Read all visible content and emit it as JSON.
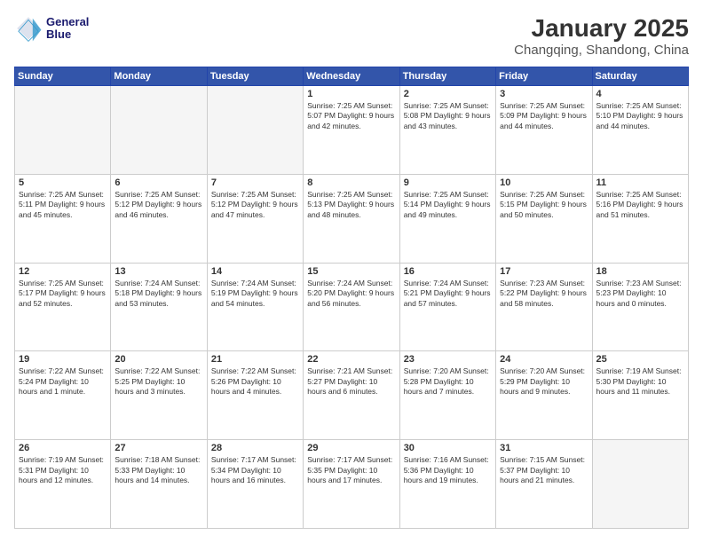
{
  "header": {
    "logo_line1": "General",
    "logo_line2": "Blue",
    "month_title": "January 2025",
    "location": "Changqing, Shandong, China"
  },
  "days_of_week": [
    "Sunday",
    "Monday",
    "Tuesday",
    "Wednesday",
    "Thursday",
    "Friday",
    "Saturday"
  ],
  "weeks": [
    [
      {
        "day": "",
        "text": ""
      },
      {
        "day": "",
        "text": ""
      },
      {
        "day": "",
        "text": ""
      },
      {
        "day": "1",
        "text": "Sunrise: 7:25 AM\nSunset: 5:07 PM\nDaylight: 9 hours\nand 42 minutes."
      },
      {
        "day": "2",
        "text": "Sunrise: 7:25 AM\nSunset: 5:08 PM\nDaylight: 9 hours\nand 43 minutes."
      },
      {
        "day": "3",
        "text": "Sunrise: 7:25 AM\nSunset: 5:09 PM\nDaylight: 9 hours\nand 44 minutes."
      },
      {
        "day": "4",
        "text": "Sunrise: 7:25 AM\nSunset: 5:10 PM\nDaylight: 9 hours\nand 44 minutes."
      }
    ],
    [
      {
        "day": "5",
        "text": "Sunrise: 7:25 AM\nSunset: 5:11 PM\nDaylight: 9 hours\nand 45 minutes."
      },
      {
        "day": "6",
        "text": "Sunrise: 7:25 AM\nSunset: 5:12 PM\nDaylight: 9 hours\nand 46 minutes."
      },
      {
        "day": "7",
        "text": "Sunrise: 7:25 AM\nSunset: 5:12 PM\nDaylight: 9 hours\nand 47 minutes."
      },
      {
        "day": "8",
        "text": "Sunrise: 7:25 AM\nSunset: 5:13 PM\nDaylight: 9 hours\nand 48 minutes."
      },
      {
        "day": "9",
        "text": "Sunrise: 7:25 AM\nSunset: 5:14 PM\nDaylight: 9 hours\nand 49 minutes."
      },
      {
        "day": "10",
        "text": "Sunrise: 7:25 AM\nSunset: 5:15 PM\nDaylight: 9 hours\nand 50 minutes."
      },
      {
        "day": "11",
        "text": "Sunrise: 7:25 AM\nSunset: 5:16 PM\nDaylight: 9 hours\nand 51 minutes."
      }
    ],
    [
      {
        "day": "12",
        "text": "Sunrise: 7:25 AM\nSunset: 5:17 PM\nDaylight: 9 hours\nand 52 minutes."
      },
      {
        "day": "13",
        "text": "Sunrise: 7:24 AM\nSunset: 5:18 PM\nDaylight: 9 hours\nand 53 minutes."
      },
      {
        "day": "14",
        "text": "Sunrise: 7:24 AM\nSunset: 5:19 PM\nDaylight: 9 hours\nand 54 minutes."
      },
      {
        "day": "15",
        "text": "Sunrise: 7:24 AM\nSunset: 5:20 PM\nDaylight: 9 hours\nand 56 minutes."
      },
      {
        "day": "16",
        "text": "Sunrise: 7:24 AM\nSunset: 5:21 PM\nDaylight: 9 hours\nand 57 minutes."
      },
      {
        "day": "17",
        "text": "Sunrise: 7:23 AM\nSunset: 5:22 PM\nDaylight: 9 hours\nand 58 minutes."
      },
      {
        "day": "18",
        "text": "Sunrise: 7:23 AM\nSunset: 5:23 PM\nDaylight: 10 hours\nand 0 minutes."
      }
    ],
    [
      {
        "day": "19",
        "text": "Sunrise: 7:22 AM\nSunset: 5:24 PM\nDaylight: 10 hours\nand 1 minute."
      },
      {
        "day": "20",
        "text": "Sunrise: 7:22 AM\nSunset: 5:25 PM\nDaylight: 10 hours\nand 3 minutes."
      },
      {
        "day": "21",
        "text": "Sunrise: 7:22 AM\nSunset: 5:26 PM\nDaylight: 10 hours\nand 4 minutes."
      },
      {
        "day": "22",
        "text": "Sunrise: 7:21 AM\nSunset: 5:27 PM\nDaylight: 10 hours\nand 6 minutes."
      },
      {
        "day": "23",
        "text": "Sunrise: 7:20 AM\nSunset: 5:28 PM\nDaylight: 10 hours\nand 7 minutes."
      },
      {
        "day": "24",
        "text": "Sunrise: 7:20 AM\nSunset: 5:29 PM\nDaylight: 10 hours\nand 9 minutes."
      },
      {
        "day": "25",
        "text": "Sunrise: 7:19 AM\nSunset: 5:30 PM\nDaylight: 10 hours\nand 11 minutes."
      }
    ],
    [
      {
        "day": "26",
        "text": "Sunrise: 7:19 AM\nSunset: 5:31 PM\nDaylight: 10 hours\nand 12 minutes."
      },
      {
        "day": "27",
        "text": "Sunrise: 7:18 AM\nSunset: 5:33 PM\nDaylight: 10 hours\nand 14 minutes."
      },
      {
        "day": "28",
        "text": "Sunrise: 7:17 AM\nSunset: 5:34 PM\nDaylight: 10 hours\nand 16 minutes."
      },
      {
        "day": "29",
        "text": "Sunrise: 7:17 AM\nSunset: 5:35 PM\nDaylight: 10 hours\nand 17 minutes."
      },
      {
        "day": "30",
        "text": "Sunrise: 7:16 AM\nSunset: 5:36 PM\nDaylight: 10 hours\nand 19 minutes."
      },
      {
        "day": "31",
        "text": "Sunrise: 7:15 AM\nSunset: 5:37 PM\nDaylight: 10 hours\nand 21 minutes."
      },
      {
        "day": "",
        "text": ""
      }
    ]
  ]
}
